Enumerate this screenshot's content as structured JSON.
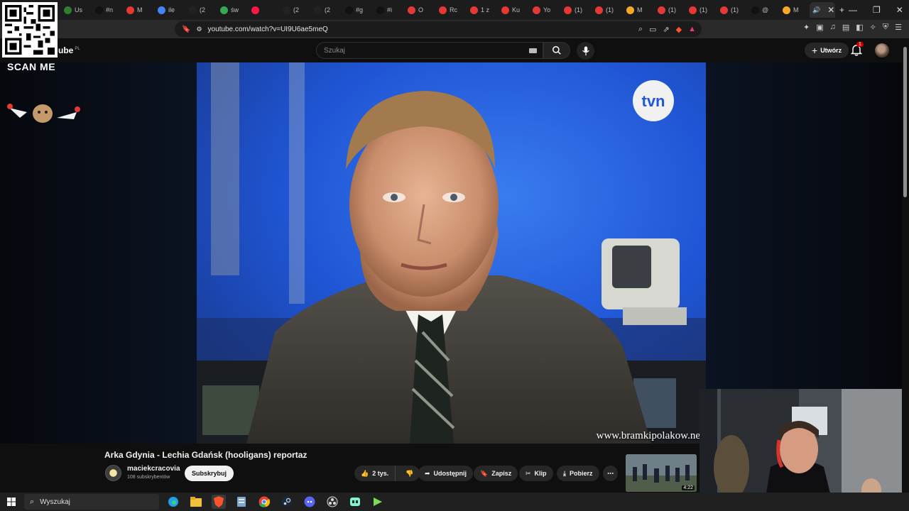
{
  "browser": {
    "tabs": [
      {
        "title": "Us",
        "color": "#2e7d32"
      },
      {
        "title": "#n",
        "color": "#111111"
      },
      {
        "title": "M",
        "color": "#e53935"
      },
      {
        "title": "ile",
        "color": "#4285f4"
      },
      {
        "title": "(2",
        "color": "#222222"
      },
      {
        "title": "św",
        "color": "#34a853"
      },
      {
        "title": "",
        "color": "#ff1744"
      },
      {
        "title": "(2",
        "color": "#222222"
      },
      {
        "title": "(2",
        "color": "#222222"
      },
      {
        "title": "#g",
        "color": "#111111"
      },
      {
        "title": "#i",
        "color": "#111111"
      },
      {
        "title": "O",
        "color": "#e53935"
      },
      {
        "title": "Rc",
        "color": "#e53935"
      },
      {
        "title": "1 z",
        "color": "#e53935"
      },
      {
        "title": "Ku",
        "color": "#e53935"
      },
      {
        "title": "Yo",
        "color": "#e53935"
      },
      {
        "title": "(1)",
        "color": "#e53935"
      },
      {
        "title": "(1)",
        "color": "#e53935"
      },
      {
        "title": "M",
        "color": "#f9a825"
      },
      {
        "title": "(1)",
        "color": "#e53935"
      },
      {
        "title": "(1)",
        "color": "#e53935"
      },
      {
        "title": "(1)",
        "color": "#e53935"
      },
      {
        "title": "@",
        "color": "#111111"
      },
      {
        "title": "M",
        "color": "#f9a825"
      }
    ],
    "url": "youtube.com/watch?v=UI9U6ae5meQ"
  },
  "overlay": {
    "scan_me": "SCAN ME"
  },
  "youtube": {
    "logo_tail": "ube",
    "country": "PL",
    "search_placeholder": "Szukaj",
    "create_label": "Utwórz",
    "notif_count": "1"
  },
  "video": {
    "channel_logo": "tvn",
    "watermark": "www.bramkipolakow.ne",
    "title": "Arka Gdynia - Lechia Gdańsk (hooligans) reportaz",
    "channel_name": "maciekcracovia",
    "subscribers": "108 subskrybentów",
    "subscribe_label": "Subskrybuj",
    "like_count": "2 tys.",
    "share_label": "Udostępnij",
    "save_label": "Zapisz",
    "clip_label": "Klip",
    "download_label": "Pobierz",
    "next_duration": "4:22"
  },
  "taskbar": {
    "search_placeholder": "Wyszukaj"
  }
}
